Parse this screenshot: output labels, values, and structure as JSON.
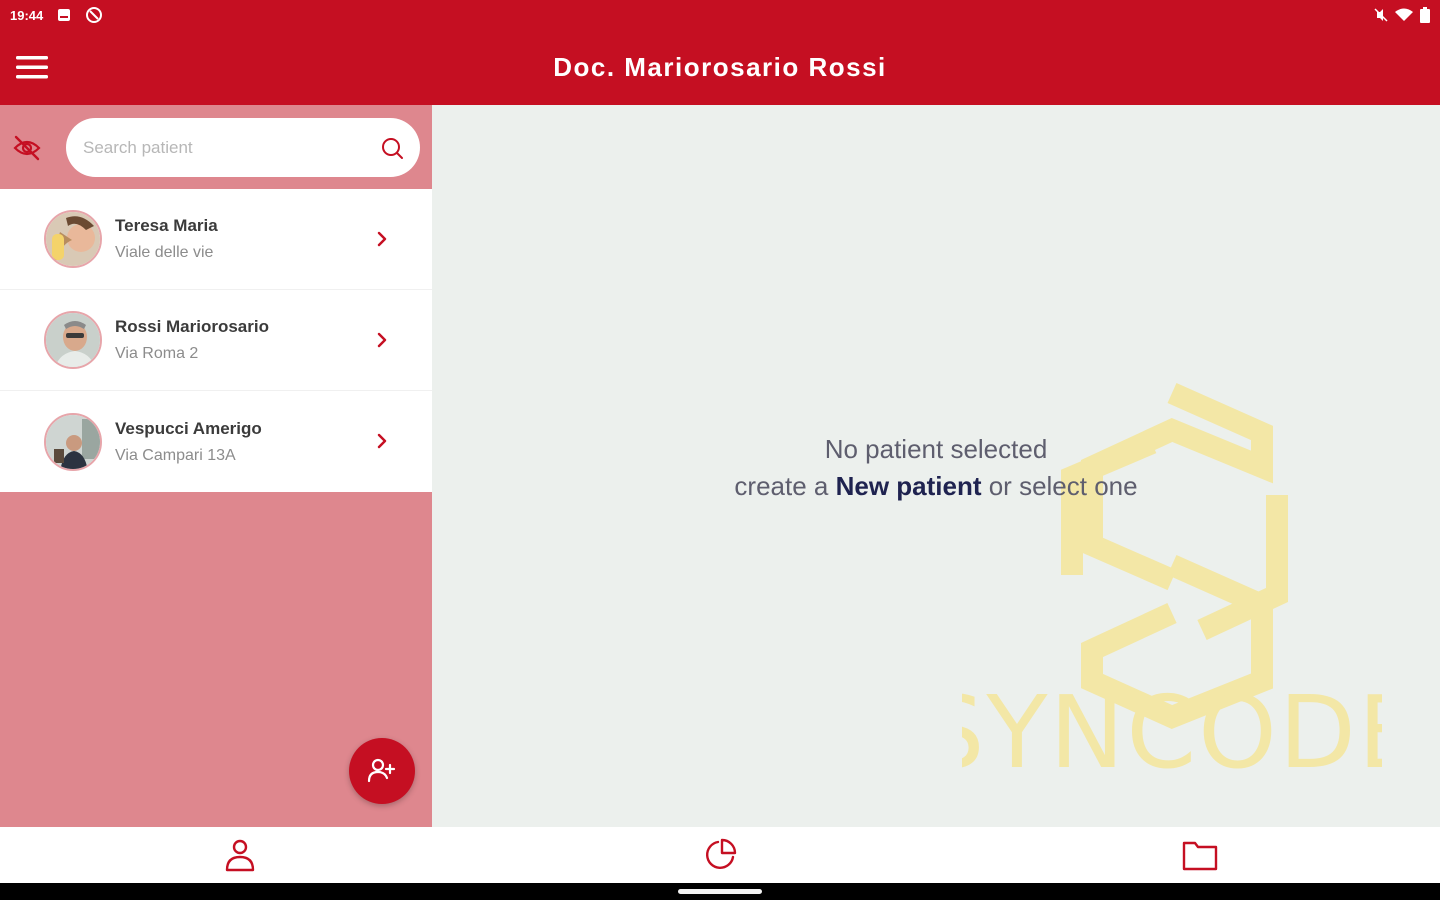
{
  "status_bar": {
    "time": "19:44"
  },
  "app_bar": {
    "title": "Doc. Mariorosario Rossi",
    "menu_icon": "hamburger-menu-icon"
  },
  "search": {
    "placeholder": "Search patient",
    "value": ""
  },
  "patients": [
    {
      "name": "Teresa Maria",
      "address": "Viale delle vie"
    },
    {
      "name": "Rossi Mariorosario",
      "address": "Via Roma 2"
    },
    {
      "name": "Vespucci Amerigo",
      "address": "Via Campari 13A"
    }
  ],
  "empty_state": {
    "line1": "No patient selected",
    "line2_prefix": "create a ",
    "line2_link": "New patient",
    "line2_suffix": " or select one"
  },
  "watermark": {
    "text": "SYNCODE"
  },
  "bottom_nav": {
    "items": [
      "person-icon",
      "pie-chart-icon",
      "folder-icon"
    ]
  },
  "colors": {
    "primary": "#c50f22",
    "panel": "#de878e",
    "background": "#ecf0ed",
    "watermark": "#f3e7a6",
    "link": "#1f2350"
  }
}
